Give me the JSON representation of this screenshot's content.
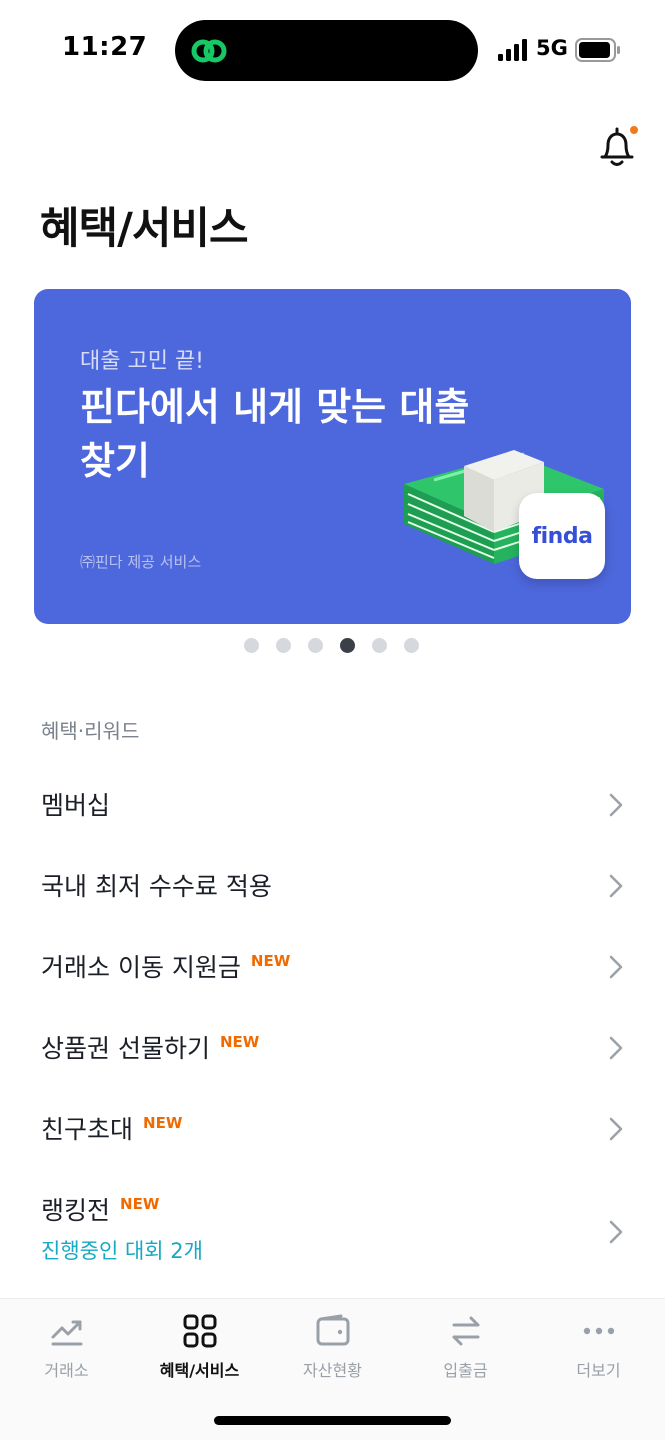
{
  "status_bar": {
    "time": "11:27",
    "network": "5G"
  },
  "header": {
    "title": "혜택/서비스"
  },
  "banner": {
    "subtitle": "대출 고민 끝!",
    "title": "핀다에서 내게 맞는 대출 찾기",
    "provider": "㈜핀다 제공 서비스",
    "badge_text": "finda",
    "background_color": "#4d67dc"
  },
  "carousel": {
    "total": 6,
    "active_index": 3
  },
  "section": {
    "label": "혜택·리워드"
  },
  "menu": [
    {
      "label": "멤버십",
      "badge": ""
    },
    {
      "label": "국내 최저 수수료 적용",
      "badge": ""
    },
    {
      "label": "거래소 이동 지원금",
      "badge": "NEW"
    },
    {
      "label": "상품권 선물하기",
      "badge": "NEW"
    },
    {
      "label": "친구초대",
      "badge": "NEW"
    },
    {
      "label": "랭킹전",
      "badge": "NEW",
      "subtitle": "진행중인 대회 2개"
    }
  ],
  "tabbar": {
    "tabs": [
      {
        "label": "거래소",
        "icon": "chart-trend-icon"
      },
      {
        "label": "혜택/서비스",
        "icon": "grid-icon",
        "active": true
      },
      {
        "label": "자산현황",
        "icon": "wallet-icon"
      },
      {
        "label": "입출금",
        "icon": "transfer-arrows-icon"
      },
      {
        "label": "더보기",
        "icon": "more-dots-icon"
      }
    ]
  },
  "colors": {
    "accent_new": "#f06a00",
    "subtitle_teal": "#16a9c4",
    "notification_dot": "#f27a1a"
  }
}
